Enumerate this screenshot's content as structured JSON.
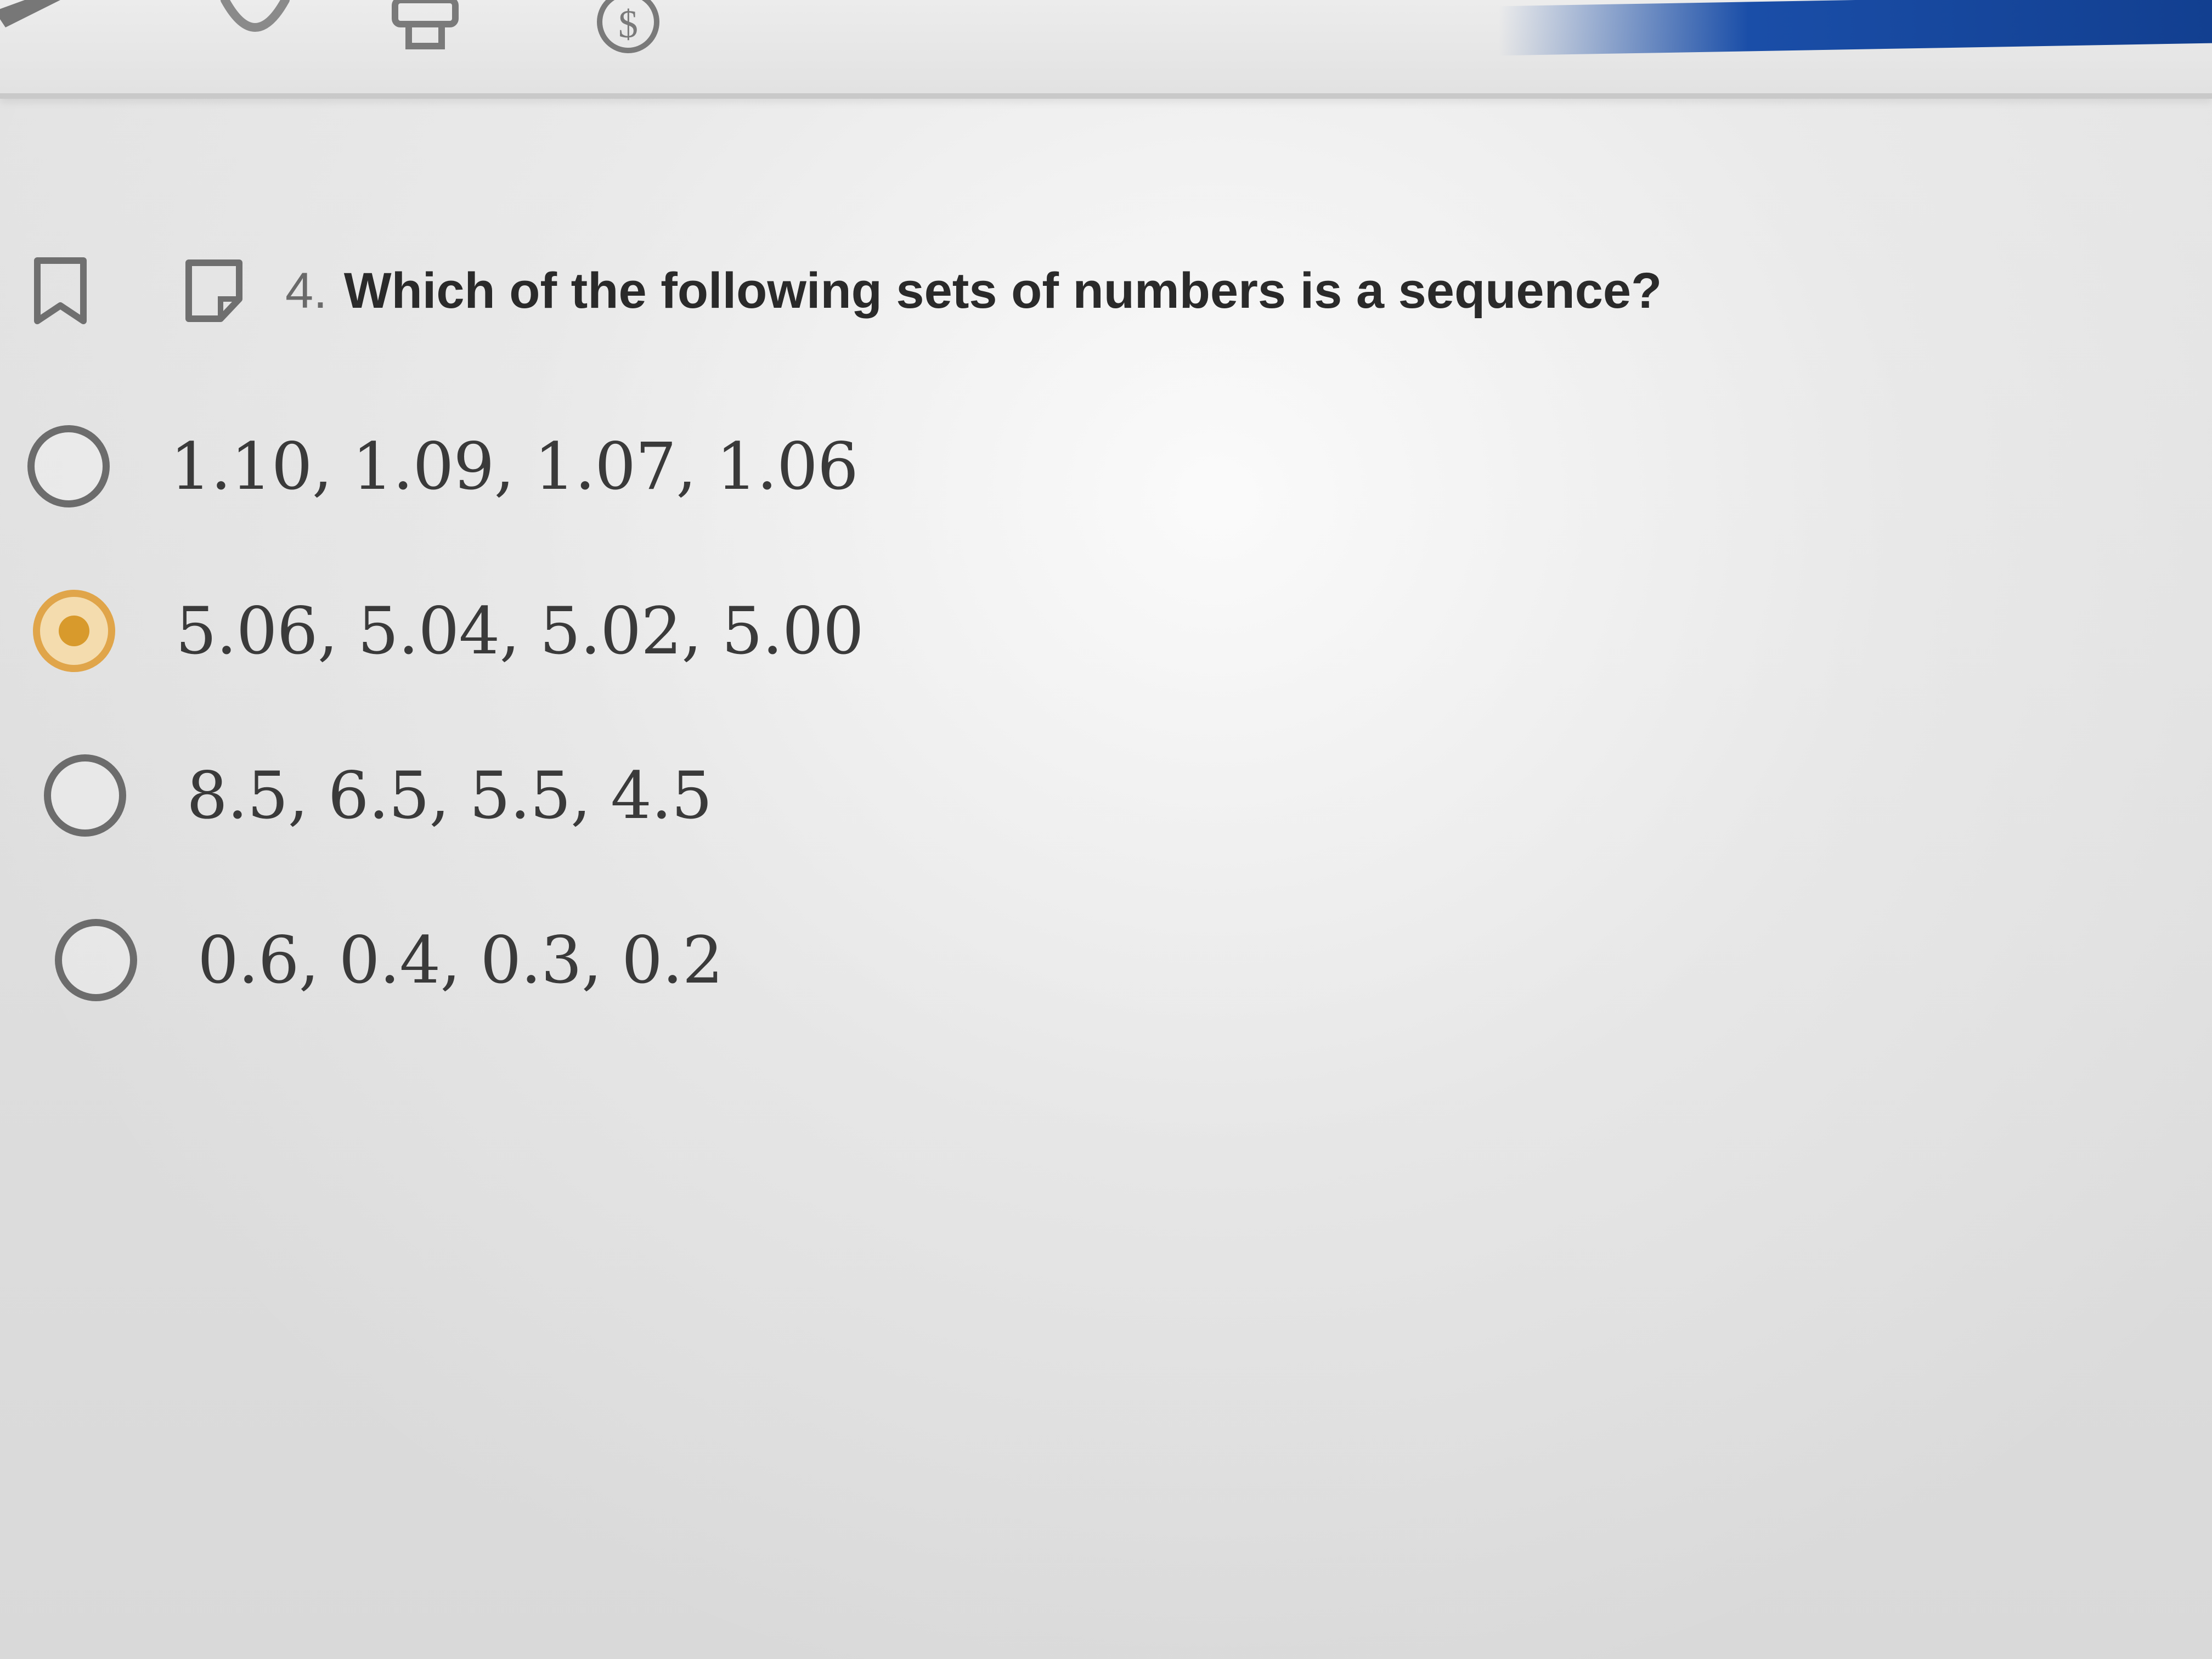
{
  "question": {
    "number": "4.",
    "text": "Which of the following sets of numbers is a sequence?"
  },
  "options": [
    {
      "label": "1.10, 1.09, 1.07, 1.06",
      "selected": false
    },
    {
      "label": "5.06, 5.04, 5.02, 5.00",
      "selected": true
    },
    {
      "label": "8.5, 6.5, 5.5, 4.5",
      "selected": false
    },
    {
      "label": "0.6, 0.4, 0.3, 0.2",
      "selected": false
    }
  ],
  "toolbar": {
    "icons": [
      "pencil-icon",
      "eraser-icon",
      "printer-icon",
      "dollar-icon"
    ],
    "accent_color": "#1a4ea8"
  },
  "colors": {
    "selected_radio": "#e0a54a",
    "unselected_radio": "#6c6c6c"
  }
}
